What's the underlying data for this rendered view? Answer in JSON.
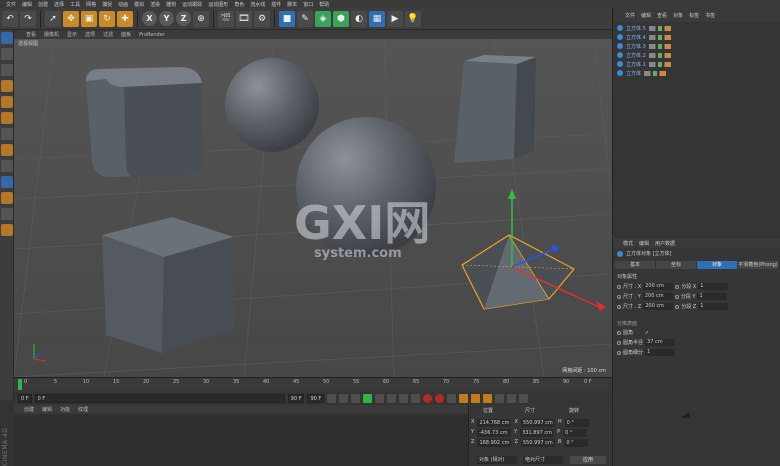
{
  "menubar": {
    "items": [
      "文件",
      "编辑",
      "创建",
      "选择",
      "工具",
      "网格",
      "捕捉",
      "动画",
      "模拟",
      "渲染",
      "雕刻",
      "运动跟踪",
      "运动图形",
      "角色",
      "流水线",
      "插件",
      "脚本",
      "窗口",
      "帮助"
    ]
  },
  "toolbar": {
    "axis_x": "X",
    "axis_y": "Y",
    "axis_z": "Z"
  },
  "viewport": {
    "menu": [
      "查看",
      "摄像机",
      "显示",
      "选项",
      "过滤",
      "面板",
      "ProRender"
    ],
    "label": "透视视图",
    "grid_info": "网格间距 : 100 cm"
  },
  "timeline": {
    "ticks": [
      "0",
      "5",
      "10",
      "15",
      "20",
      "25",
      "30",
      "35",
      "40",
      "45",
      "50",
      "55",
      "60",
      "65",
      "70",
      "75",
      "80",
      "85",
      "90"
    ],
    "end_label": "0 F",
    "start_field": "0 F",
    "current_field": "0 F",
    "end_field": "90 F",
    "max_field": "90 F"
  },
  "material": {
    "menu": [
      "创建",
      "编辑",
      "功能",
      "纹理"
    ],
    "brand": "CINEMA 4D"
  },
  "coordinates": {
    "headers": [
      "位置",
      "尺寸",
      "旋转"
    ],
    "rows": [
      {
        "axis": "X",
        "pos": "214.768 cm",
        "size_axis": "X",
        "size": "550.997 cm",
        "rot_axis": "H",
        "rot": "0 °"
      },
      {
        "axis": "Y",
        "pos": "-436.73 cm",
        "size_axis": "Y",
        "size": "331.897 cm",
        "rot_axis": "P",
        "rot": "0 °"
      },
      {
        "axis": "Z",
        "pos": "168.902 cm",
        "size_axis": "Z",
        "size": "550.997 cm",
        "rot_axis": "B",
        "rot": "0 °"
      }
    ],
    "mode_select": "对象 (相对)",
    "size_select": "绝对尺寸",
    "apply_label": "应用"
  },
  "object_manager": {
    "menu": [
      "文件",
      "编辑",
      "查看",
      "对象",
      "标签",
      "书签"
    ],
    "objects": [
      "立方体.5",
      "立方体.4",
      "立方体.3",
      "立方体.2",
      "立方体.1",
      "立方体"
    ]
  },
  "attributes": {
    "menu": [
      "模式",
      "编辑",
      "用户数据"
    ],
    "title": "立方体对象 [立方体]",
    "tabs": [
      "基本",
      "坐标",
      "对象",
      "平滑着色(Phong)"
    ],
    "active_tab": 2,
    "section": "对象属性",
    "size_rows": [
      {
        "label": "尺寸 . X",
        "value": "200 cm",
        "seg_label": "分段 X",
        "seg": "1"
      },
      {
        "label": "尺寸 . Y",
        "value": "200 cm",
        "seg_label": "分段 Y",
        "seg": "1"
      },
      {
        "label": "尺寸 . Z",
        "value": "200 cm",
        "seg_label": "分段 Z",
        "seg": "1"
      }
    ],
    "separate_surfaces": "分离表面",
    "fillet": "圆角",
    "fillet_check": "✓",
    "fillet_radius_label": "圆角半径",
    "fillet_radius": "37 cm",
    "fillet_subdiv_label": "圆角细分",
    "fillet_subdiv": "1"
  },
  "watermark": {
    "logo": "GXI网",
    "domain": "system.com"
  },
  "colors": {
    "accent_blue": "#2f6fb3",
    "selection_orange": "#f0a020",
    "axis_x": "#e03030",
    "axis_y": "#30c040",
    "axis_z": "#3050e0"
  }
}
